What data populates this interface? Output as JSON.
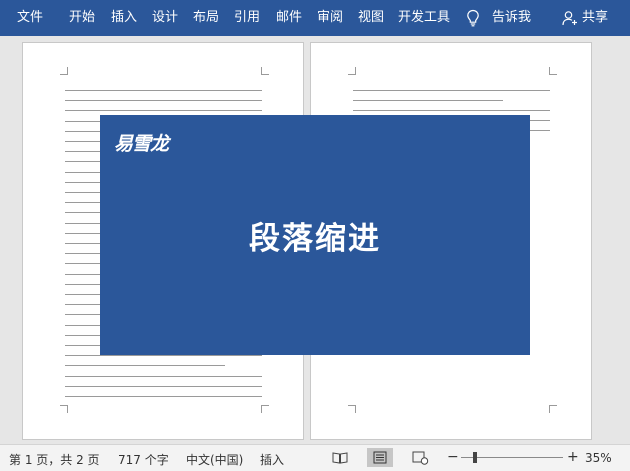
{
  "ribbon": {
    "tabs": [
      "文件",
      "开始",
      "插入",
      "设计",
      "布局",
      "引用",
      "邮件",
      "审阅",
      "视图",
      "开发工具"
    ],
    "tell_me": "告诉我",
    "share": "共享",
    "bg_color": "#2b579a"
  },
  "overlay": {
    "logo": "易雪龙",
    "title": "段落缩进",
    "bg_color": "#2b579a"
  },
  "status": {
    "page_info": "第 1 页，共 2 页",
    "word_count": "717 个字",
    "language": "中文(中国)",
    "mode": "插入",
    "zoom_out": "−",
    "zoom_in": "+",
    "zoom": "35%",
    "view_icons": [
      "read-mode-icon",
      "print-layout-icon",
      "web-layout-icon"
    ]
  }
}
